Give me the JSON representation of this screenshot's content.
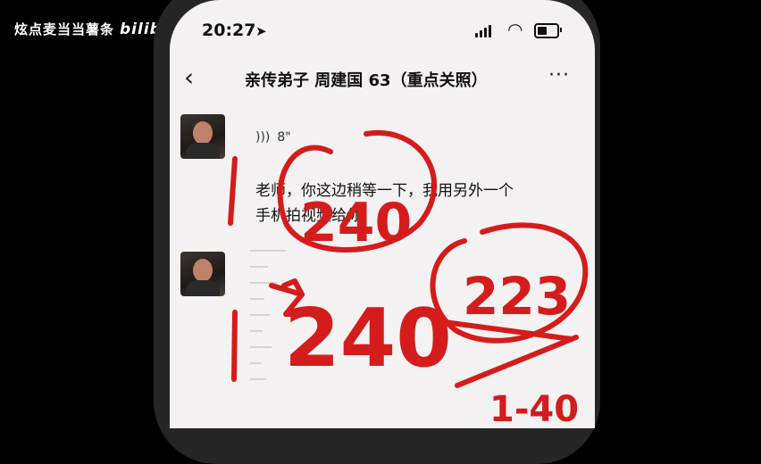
{
  "overlay": {
    "channel": "炫点麦当当薯条",
    "logo": "bilibili"
  },
  "status_bar": {
    "time": "20:27",
    "location_arrow": "➤"
  },
  "chat": {
    "back_glyph": "‹",
    "title": "亲传弟子 周建国 63（重点关照）",
    "more_glyph": "···",
    "voice_duration": "8\"",
    "message_text": "老师，你这边稍等一下，我用另外一个手机拍视频给你"
  },
  "annotations": [
    "240",
    "223",
    "240",
    "1-40"
  ],
  "colors": {
    "ink": "#d41c1c",
    "screen_bg": "#f3f1f1",
    "bezel": "#262626"
  }
}
